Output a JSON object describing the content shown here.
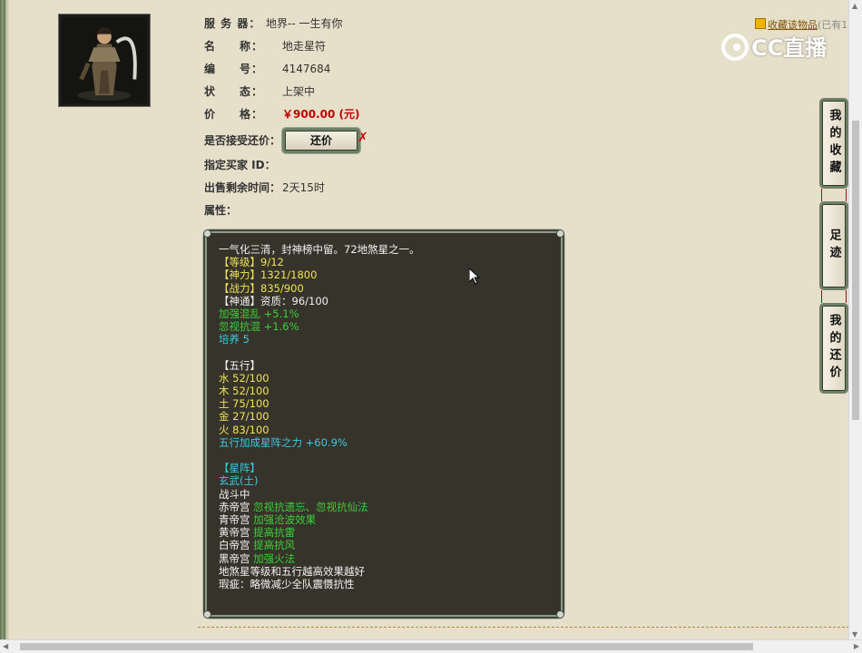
{
  "info": {
    "server": {
      "label": "服 务 器：",
      "value": "地界-- 一生有你"
    },
    "name": {
      "label": "名　　称：",
      "value": "地走星符"
    },
    "id": {
      "label": "编　　号：",
      "value": "4147684"
    },
    "status": {
      "label": "状　　态：",
      "value": "上架中"
    },
    "price": {
      "label": "价　　格：",
      "value": "￥900.00 (元)"
    },
    "accept_counter": {
      "label": "是否接受还价：",
      "button": "还价",
      "mark": "✗"
    },
    "buyer": {
      "label": "指定买家 ID："
    },
    "remaining": {
      "label": "出售剩余时间：",
      "value": "2天15时"
    },
    "attributes": {
      "label": "属性："
    }
  },
  "attribute_lines": [
    {
      "text": "一气化三清，封神榜中留。72地煞星之一。",
      "color": "w"
    },
    {
      "text": "【等级】9/12",
      "color": "y"
    },
    {
      "text": "【神力】1321/1800",
      "color": "y"
    },
    {
      "text": "【战力】835/900",
      "color": "y"
    },
    {
      "text": "【神通】资质：96/100",
      "color": "w"
    },
    {
      "text": "加强混乱 +5.1%",
      "color": "g"
    },
    {
      "text": "忽视抗混 +1.6%",
      "color": "g"
    },
    {
      "text": "培养 5",
      "color": "c"
    },
    {
      "text": "",
      "color": "w"
    },
    {
      "text": "【五行】",
      "color": "w"
    },
    {
      "text": "水 52/100",
      "color": "y"
    },
    {
      "text": "木 52/100",
      "color": "y"
    },
    {
      "text": "土 75/100",
      "color": "y"
    },
    {
      "text": "金 27/100",
      "color": "y"
    },
    {
      "text": "火 83/100",
      "color": "y"
    },
    {
      "text": "五行加成星阵之力 +60.9%",
      "color": "c"
    },
    {
      "text": "",
      "color": "w"
    },
    {
      "text": "【星阵】",
      "color": "c"
    },
    {
      "text": "玄武(土)",
      "color": "c"
    },
    {
      "text": "战斗中",
      "color": "w"
    },
    {
      "parts": [
        {
          "text": "赤帝宫 ",
          "color": "w"
        },
        {
          "text": "忽视抗遗忘、忽视抗仙法",
          "color": "g"
        }
      ]
    },
    {
      "parts": [
        {
          "text": "青帝宫 ",
          "color": "w"
        },
        {
          "text": "加强沧波效果",
          "color": "g"
        }
      ]
    },
    {
      "parts": [
        {
          "text": "黄帝宫 ",
          "color": "w"
        },
        {
          "text": "提高抗雷",
          "color": "g"
        }
      ]
    },
    {
      "parts": [
        {
          "text": "白帝宫 ",
          "color": "w"
        },
        {
          "text": "提高抗风",
          "color": "g"
        }
      ]
    },
    {
      "parts": [
        {
          "text": "黑帝宫 ",
          "color": "w"
        },
        {
          "text": "加强火法",
          "color": "g"
        }
      ]
    },
    {
      "text": "地煞星等级和五行越高效果越好",
      "color": "w"
    },
    {
      "text": "瑕疵：略微减少全队震慑抗性",
      "color": "w"
    }
  ],
  "favorite": {
    "link": "收藏该物品",
    "note": "(已有1"
  },
  "logo": {
    "text": "CC直播"
  },
  "side_tabs": [
    {
      "label": "我的收藏"
    },
    {
      "label": "足迹"
    },
    {
      "label": "我的还价"
    }
  ],
  "colors": {
    "background": "#e6dfca",
    "attr_bg": "#35332a",
    "yellow": "#f0e35a",
    "green": "#3ad13a",
    "cyan": "#3ec8e0",
    "price": "#c00000"
  },
  "icons": [
    "portrait-image",
    "favorite-icon",
    "cc-logo-icon",
    "close-x-icon",
    "mouse-cursor-icon"
  ]
}
